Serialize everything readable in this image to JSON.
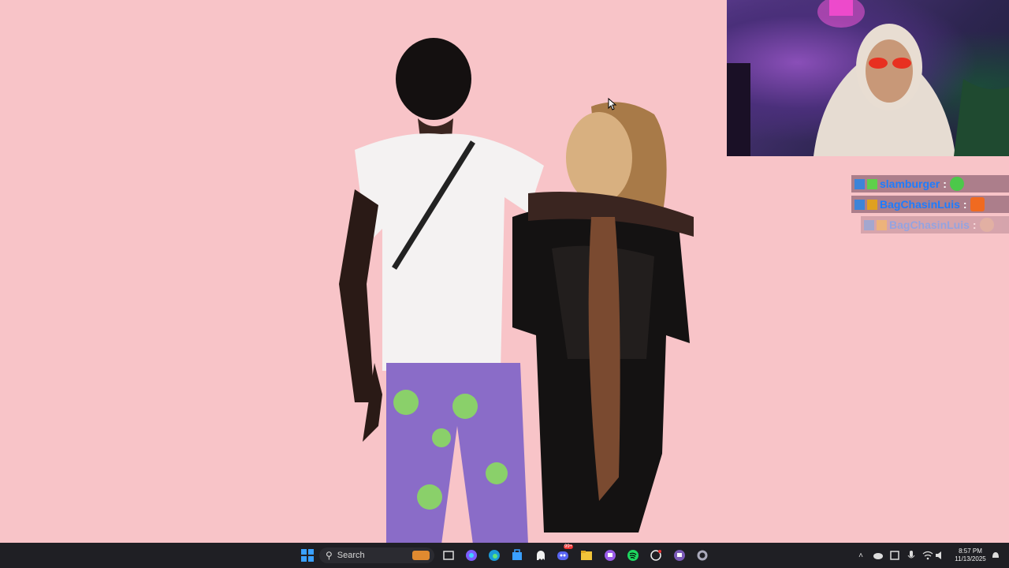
{
  "overlay": {
    "chat": [
      {
        "username": "slamburger",
        "color": "#1c7cff",
        "emote": "frog-emote"
      },
      {
        "username": "BagChasinLuis",
        "color": "#1c7cff",
        "emote": "w-emote"
      },
      {
        "username": "BagChasinLuis",
        "color": "#1c7cff",
        "emote": "face-emote"
      }
    ],
    "separator": ":"
  },
  "taskbar": {
    "search_label": "Search",
    "time": "8:57 PM",
    "date": "11/13/2025",
    "discord_badge": "99+",
    "apps": [
      "windows-start",
      "search",
      "task-view",
      "copilot",
      "edge",
      "store",
      "ghost-app",
      "discord",
      "file-explorer",
      "twitch",
      "spotify",
      "chatgpt",
      "twitch-alt",
      "settings"
    ]
  },
  "colors": {
    "background": "#f8c4c8",
    "taskbar": "#1f1f24",
    "chat_username": "#1c7cff"
  }
}
